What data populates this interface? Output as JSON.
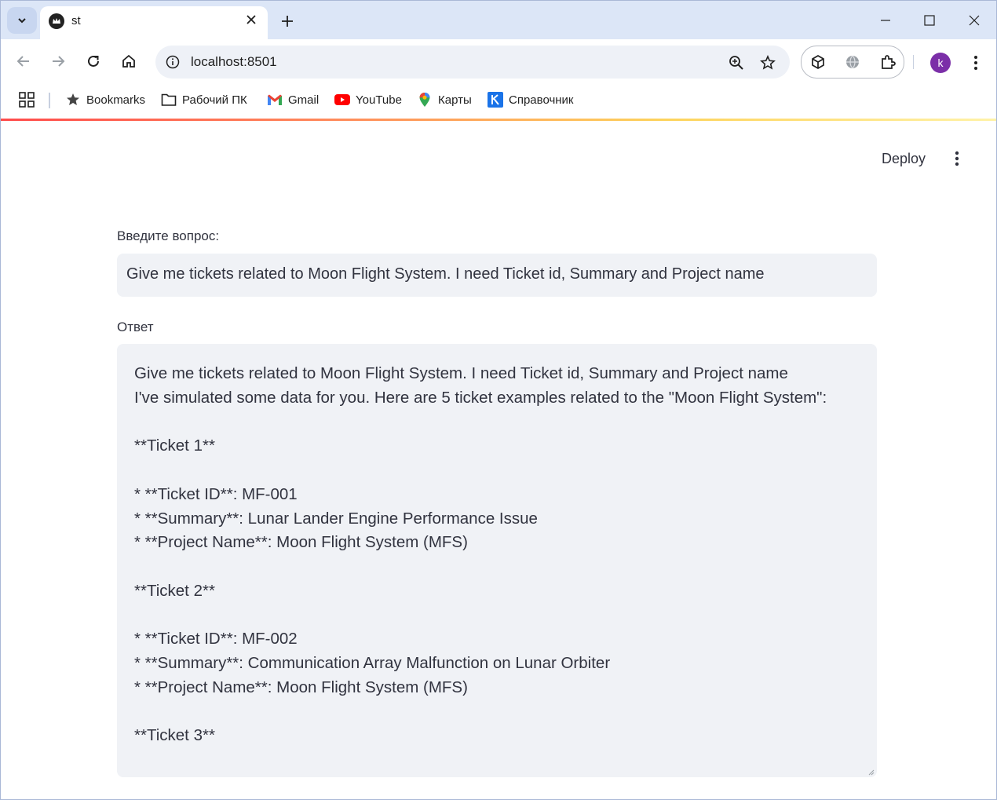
{
  "browser": {
    "tab_title": "st",
    "url": "localhost:8501",
    "avatar_letter": "k",
    "bookmarks": [
      {
        "label": "Bookmarks",
        "icon": "star-icon"
      },
      {
        "label": "Рабочий ПК",
        "icon": "folder-icon"
      },
      {
        "label": "Gmail",
        "icon": "gmail-icon"
      },
      {
        "label": "YouTube",
        "icon": "youtube-icon"
      },
      {
        "label": "Карты",
        "icon": "maps-pin-icon"
      },
      {
        "label": "Справочник",
        "icon": "k-logo-icon"
      }
    ]
  },
  "app": {
    "deploy_label": "Deploy",
    "question_label": "Введите вопрос:",
    "question_value": "Give me tickets related to Moon Flight System. I need Ticket id, Summary and Project name",
    "answer_label": "Ответ",
    "answer_lines": [
      "Give me tickets related to Moon Flight System. I need Ticket id, Summary and Project name",
      "I've simulated some data for you. Here are 5 ticket examples related to the \"Moon Flight System\":",
      "",
      "**Ticket 1**",
      "",
      "* **Ticket ID**: MF-001",
      "* **Summary**: Lunar Lander Engine Performance Issue",
      "* **Project Name**: Moon Flight System (MFS)",
      "",
      "**Ticket 2**",
      "",
      "* **Ticket ID**: MF-002",
      "* **Summary**: Communication Array Malfunction on Lunar Orbiter",
      "* **Project Name**: Moon Flight System (MFS)",
      "",
      "**Ticket 3**"
    ]
  },
  "colors": {
    "accent": "#ff4b4b",
    "input_bg": "#f0f2f6",
    "text": "#31333f",
    "tabstrip": "#dce6f7"
  }
}
